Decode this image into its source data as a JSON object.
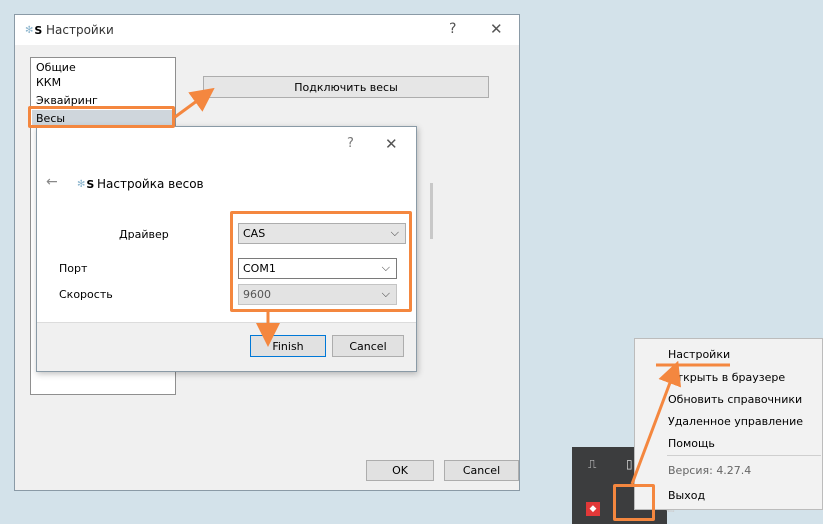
{
  "main_window": {
    "title": "Настройки",
    "help": "?",
    "close": "✕",
    "sidebar": {
      "items": [
        {
          "label": "Общие"
        },
        {
          "label": "ККМ"
        },
        {
          "label": "Эквайринг"
        },
        {
          "label": "Весы"
        }
      ]
    },
    "connect_scales_label": "Подключить весы",
    "ok_label": "OK",
    "cancel_label": "Cancel"
  },
  "dialog": {
    "help": "?",
    "close": "✕",
    "back": "←",
    "title": "Настройка весов",
    "driver_label": "Драйвер",
    "driver_value": "CAS",
    "port_label": "Порт",
    "port_value": "COM1",
    "speed_label": "Скорость",
    "speed_value": "9600",
    "finish_label": "Finish",
    "cancel_label": "Cancel"
  },
  "logo_letter": "S",
  "context_menu": {
    "items": [
      "Настройки",
      "Открыть в браузере",
      "Обновить справочники",
      "Удаленное управление",
      "Помощь"
    ],
    "version": "Версия: 4.27.4",
    "exit": "Выход"
  },
  "colors": {
    "annotation": "#f4873f",
    "background": "#d3e2ea",
    "tray": "#3c3d3e"
  }
}
